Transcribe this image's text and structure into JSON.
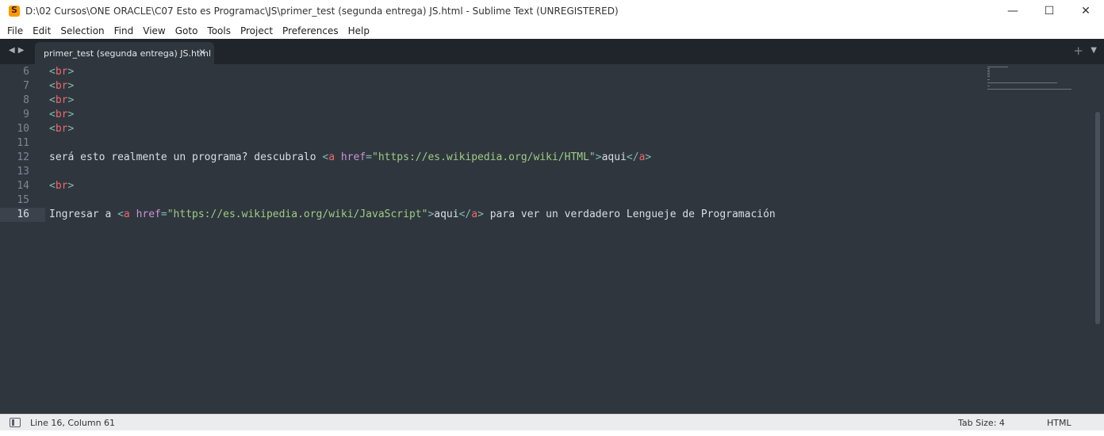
{
  "window": {
    "title": "D:\\02 Cursos\\ONE ORACLE\\C07 Esto es Programac\\JS\\primer_test (segunda entrega) JS.html - Sublime Text (UNREGISTERED)",
    "minimize_glyph": "—",
    "maximize_glyph": "☐",
    "close_glyph": "✕"
  },
  "menu": [
    "File",
    "Edit",
    "Selection",
    "Find",
    "View",
    "Goto",
    "Tools",
    "Project",
    "Preferences",
    "Help"
  ],
  "tabs": {
    "back_glyph": "◀",
    "forward_glyph": "▶",
    "active_tab": "primer_test (segunda entrega) JS.html",
    "close_glyph": "✕",
    "new_tab_glyph": "+",
    "dropdown_glyph": "▼"
  },
  "editor": {
    "current_line": 16,
    "line_numbers": [
      "6",
      "7",
      "8",
      "9",
      "10",
      "11",
      "12",
      "13",
      "14",
      "15",
      "16"
    ],
    "lines": [
      {
        "num": 6,
        "tokens": [
          [
            "punct",
            "<"
          ],
          [
            "tag",
            "br"
          ],
          [
            "punct",
            ">"
          ]
        ]
      },
      {
        "num": 7,
        "tokens": [
          [
            "punct",
            "<"
          ],
          [
            "tag",
            "br"
          ],
          [
            "punct",
            ">"
          ]
        ]
      },
      {
        "num": 8,
        "tokens": [
          [
            "punct",
            "<"
          ],
          [
            "tag",
            "br"
          ],
          [
            "punct",
            ">"
          ]
        ]
      },
      {
        "num": 9,
        "tokens": [
          [
            "punct",
            "<"
          ],
          [
            "tag",
            "br"
          ],
          [
            "punct",
            ">"
          ]
        ]
      },
      {
        "num": 10,
        "tokens": [
          [
            "punct",
            "<"
          ],
          [
            "tag",
            "br"
          ],
          [
            "punct",
            ">"
          ]
        ]
      },
      {
        "num": 11,
        "tokens": []
      },
      {
        "num": 12,
        "tokens": [
          [
            "text",
            "será esto realmente un programa? descubralo "
          ],
          [
            "punct",
            "<"
          ],
          [
            "tag",
            "a"
          ],
          [
            "text",
            " "
          ],
          [
            "attr",
            "href"
          ],
          [
            "punct",
            "="
          ],
          [
            "str",
            "\"https://es.wikipedia.org/wiki/HTML\""
          ],
          [
            "punct",
            ">"
          ],
          [
            "text",
            "aqui"
          ],
          [
            "punct",
            "</"
          ],
          [
            "tag",
            "a"
          ],
          [
            "punct",
            ">"
          ]
        ]
      },
      {
        "num": 13,
        "tokens": []
      },
      {
        "num": 14,
        "tokens": [
          [
            "punct",
            "<"
          ],
          [
            "tag",
            "br"
          ],
          [
            "punct",
            ">"
          ]
        ]
      },
      {
        "num": 15,
        "tokens": []
      },
      {
        "num": 16,
        "tokens": [
          [
            "text",
            "Ingresar a "
          ],
          [
            "punct",
            "<"
          ],
          [
            "tag",
            "a"
          ],
          [
            "text",
            " "
          ],
          [
            "attr",
            "href"
          ],
          [
            "punct",
            "="
          ],
          [
            "str",
            "\"https://es.wikipedia.org/wiki/JavaScript\""
          ],
          [
            "punct",
            ">"
          ],
          [
            "text",
            "aqui"
          ],
          [
            "punct",
            "</"
          ],
          [
            "tag",
            "a"
          ],
          [
            "punct",
            ">"
          ],
          [
            "text",
            " para ver un verdadero Lengueje de Programación"
          ]
        ]
      }
    ]
  },
  "statusbar": {
    "position": "Line 16, Column 61",
    "tab_size": "Tab Size: 4",
    "syntax": "HTML"
  }
}
